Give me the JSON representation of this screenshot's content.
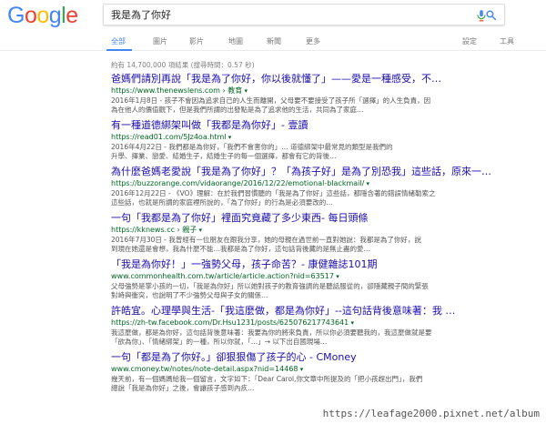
{
  "brand": {
    "letters": [
      {
        "ch": "G",
        "color": "#4285f4"
      },
      {
        "ch": "o",
        "color": "#ea4335"
      },
      {
        "ch": "o",
        "color": "#fbbc05"
      },
      {
        "ch": "g",
        "color": "#4285f4"
      },
      {
        "ch": "l",
        "color": "#34a853"
      },
      {
        "ch": "e",
        "color": "#ea4335"
      }
    ]
  },
  "search": {
    "query": "我是為了你好"
  },
  "tabs": [
    {
      "label": "全部",
      "active": true
    },
    {
      "label": "圖片",
      "active": false
    },
    {
      "label": "影片",
      "active": false
    },
    {
      "label": "地圖",
      "active": false
    },
    {
      "label": "新聞",
      "active": false
    },
    {
      "label": "更多",
      "active": false
    }
  ],
  "tools": {
    "settings": "設定",
    "tools": "工具"
  },
  "stats": "約有 14,700,000 項結果 (搜尋時間：0.57 秒)",
  "results": [
    {
      "title": "爸媽們請別再說「我是為了你好，你以後就懂了」——愛是一種感受，不…",
      "url": "https://www.thenewslens.com › 教育",
      "snippet1": "2016年1月8日 - 孩子不會因為追求自己的人生而離開，父母要不要接受了孩子所「選擇」的人生負責，因",
      "snippet2": "為在他人的價值觀下，但是我們所謂的出發點是為了追求他的生活，共同為了家庭…"
    },
    {
      "title": "有一種道德綁架叫做「我都是為你好」- 壹讀",
      "url": "https://read01.com/5Jz4oa.html",
      "snippet1": "2016年4月22日 - 我們都是為你好，「我們不會害你的」… 道德綁架中最常見的類型是我們的",
      "snippet2": "升學、擇業、戀愛、結婚生子，結婚生子的每一個選擇，都會有它的背後…"
    },
    {
      "title": "為什麼爸媽老愛說「我是為了你好」？「為孩子好」是為了別恐我」這些話，原來一…",
      "url": "https://buzzorange.com/vidaorange/2016/12/22/emotional-blackmail/",
      "snippet1": "2016年12月22日 - 《VO》理解：在於我們習慣聽的「我是為了你好」這些話，都隱含著的錯誤情緒勒索之",
      "snippet2": "這些話，也就是所謂的家庭裡所說的，「為了你好」的行為是必須要改的…"
    },
    {
      "title": "一句「我都是為了你好」裡面究竟藏了多少東西- 每日頭條",
      "url": "https://kknews.cc › 親子",
      "snippet1": "2016年7月30日 - 我曾經有一位朋友在跟我分享，她的母親在過世前一直對她說：我都是為了你好，說",
      "snippet2": "到現在她還是會想，我為什麼不能…我都是為了你好，這句話背後藏的是無止盡的愛…"
    },
    {
      "title": "「我是為你好！」一強勢父母，孩子命苦？- 康健雜誌101期",
      "url": "www.commonhealth.com.tw/article/article.action?nid=63517",
      "snippet1": "父母強勢是掌小孩的一切，「我是為你好」所以她對孩子的教育強調的是聽話服從的，卻隱藏親子間的緊張",
      "snippet2": "對峙與衝突，也說明了不少強勢父母與子女的關係…"
    },
    {
      "title": "許皓宜。心理學與生活-「我這麼做，都是為你好」--這句話背後意味著：我 …",
      "url": "https://zh-tw.facebook.com/Dr.Hsu1231/posts/625076217743641",
      "snippet1": "我這麼做，都是為你好，這句話背後意味著：我要為你的將來負責，所以你必須要聽我的，我這麼做就是要",
      "snippet2": "「欲為你」、「情緒綁架」的一種，所以你就，「…」→ 以下出自國現場…"
    },
    {
      "title": "一句「都是為了你好。」卻狠狠傷了孩子的心 - CMoney",
      "url": "www.cmoney.tw/notes/note-detail.aspx?nid=14468",
      "snippet1": "幾天前，有一個媽媽給我一個留言，文字如下：「Dear Carol,你文章中所提及的「把小孩趕出門」，我們",
      "snippet2": "總說「我是為你好」之後，會讓孩子感到內疚…"
    }
  ],
  "watermark": "https://leafage2000.pixnet.net/album"
}
